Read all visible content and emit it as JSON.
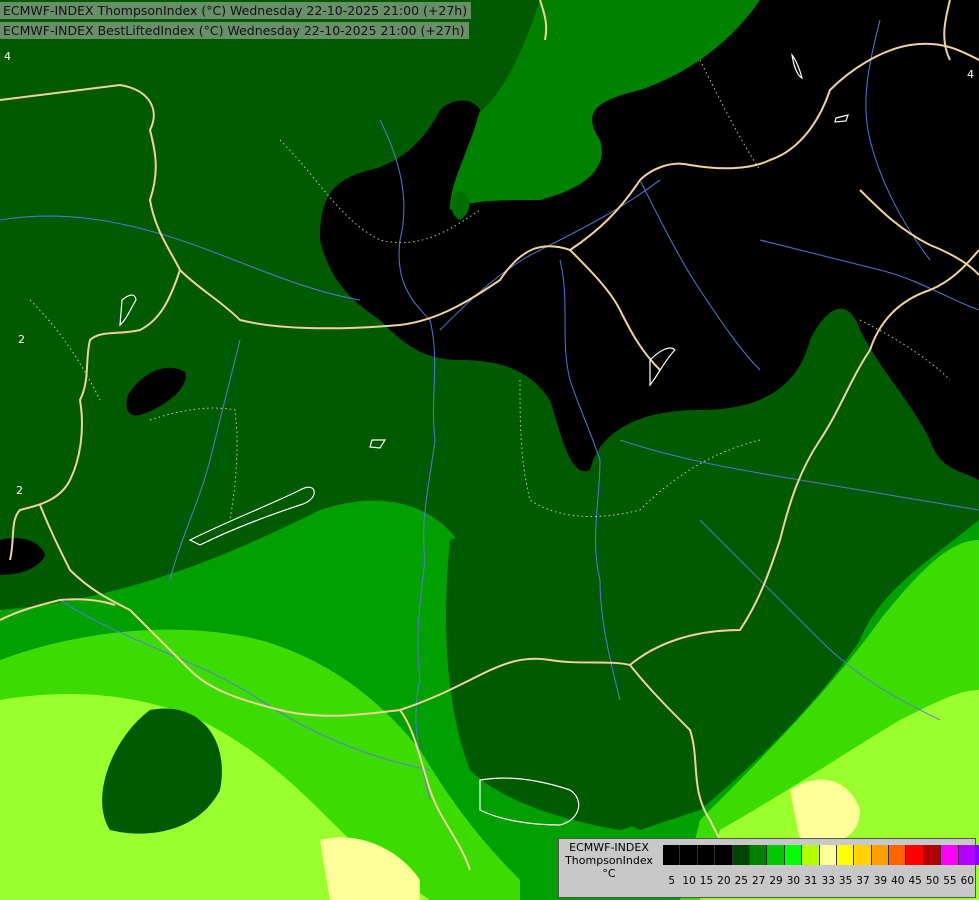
{
  "header": {
    "line1": "ECMWF-INDEX ThompsonIndex (°C) Wednesday 22-10-2025 21:00 (+27h)",
    "line2": "ECMWF-INDEX BestLiftedIndex (°C) Wednesday 22-10-2025 21:00 (+27h)"
  },
  "contour_labels": [
    "4",
    "2",
    "2",
    "4"
  ],
  "legend": {
    "title_line1": "ECMWF-INDEX",
    "title_line2": "ThompsonIndex",
    "unit": "°C",
    "colors": [
      "#000000",
      "#000000",
      "#000000",
      "#000000",
      "#004600",
      "#008200",
      "#00c800",
      "#00ff00",
      "#b4ff00",
      "#ffff99",
      "#ffff00",
      "#ffd200",
      "#ffa000",
      "#ff6400",
      "#ff0000",
      "#b40000",
      "#ff00ff",
      "#b400ff",
      "#8c00ff",
      "#5a00ff",
      "#0000ff"
    ],
    "ticks": [
      "5",
      "10",
      "15",
      "20",
      "25",
      "27",
      "29",
      "30",
      "31",
      "33",
      "35",
      "37",
      "39",
      "40",
      "45",
      "50",
      "55",
      "60"
    ]
  },
  "palette": {
    "dark_green": "#005a00",
    "darker_green": "#004600",
    "mid_green": "#008200",
    "green": "#00b400",
    "bright_green": "#3cdc00",
    "lime": "#9bff2d",
    "pale_yellow": "#ffff99",
    "border_color": "#f0d29b",
    "river_color": "#5a78dc"
  }
}
